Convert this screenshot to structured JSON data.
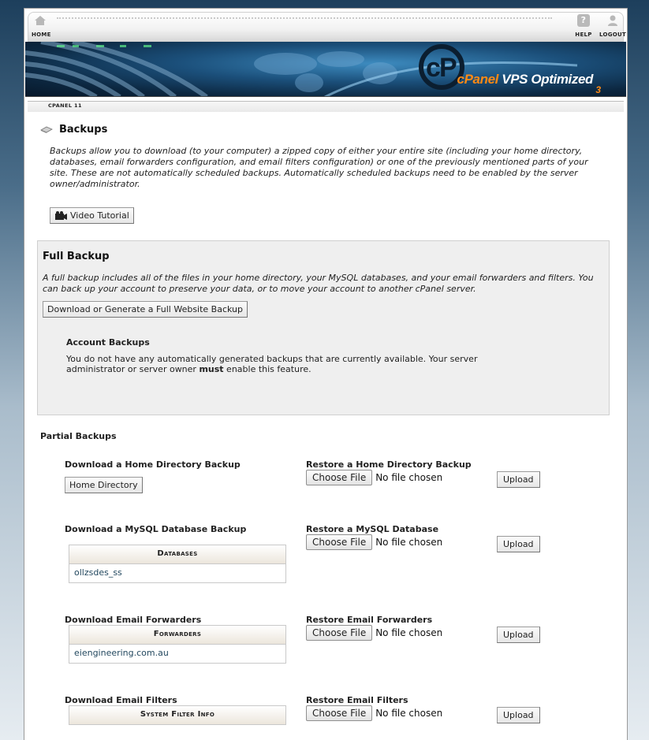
{
  "nav": {
    "home": "HOME",
    "help": "HELP",
    "logout": "LOGOUT"
  },
  "banner": {
    "brand_prefix": "cPanel",
    "brand_suffix": "VPS Optimized",
    "version": "3"
  },
  "breadcrumb": "CPANEL 11",
  "page": {
    "title": "Backups",
    "intro": "Backups allow you to download (to your computer) a zipped copy of either your entire site (including your home directory, databases, email forwarders configuration, and email filters configuration) or one of the previously mentioned parts of your site. These are not automatically scheduled backups. Automatically scheduled backups need to be enabled by the server owner/administrator.",
    "video_button": "Video Tutorial"
  },
  "full_backup": {
    "title": "Full Backup",
    "description": "A full backup includes all of the files in your home directory, your MySQL databases, and your email forwarders and filters. You can back up your account to preserve your data, or to move your account to another cPanel server.",
    "button": "Download or Generate a Full Website Backup",
    "account_title": "Account Backups",
    "account_desc_pre": "You do not have any automatically generated backups that are currently available. Your server administrator or server owner ",
    "account_desc_bold": "must",
    "account_desc_post": " enable this feature."
  },
  "partial": {
    "title": "Partial Backups",
    "home": {
      "download_title": "Download a Home Directory Backup",
      "download_button": "Home Directory",
      "restore_title": "Restore a Home Directory Backup"
    },
    "mysql": {
      "download_title": "Download a MySQL Database Backup",
      "table_header": "Databases",
      "items": [
        "ollzsdes_ss"
      ],
      "restore_title": "Restore a MySQL Database"
    },
    "forwarders": {
      "download_title": "Download Email Forwarders",
      "table_header": "Forwarders",
      "items": [
        "eiengineering.com.au"
      ],
      "restore_title": "Restore Email Forwarders"
    },
    "filters": {
      "download_title": "Download Email Filters",
      "table_header": "System Filter Info",
      "restore_title": "Restore Email Filters"
    },
    "choose_file": "Choose File",
    "no_file": "No file chosen",
    "upload": "Upload"
  }
}
